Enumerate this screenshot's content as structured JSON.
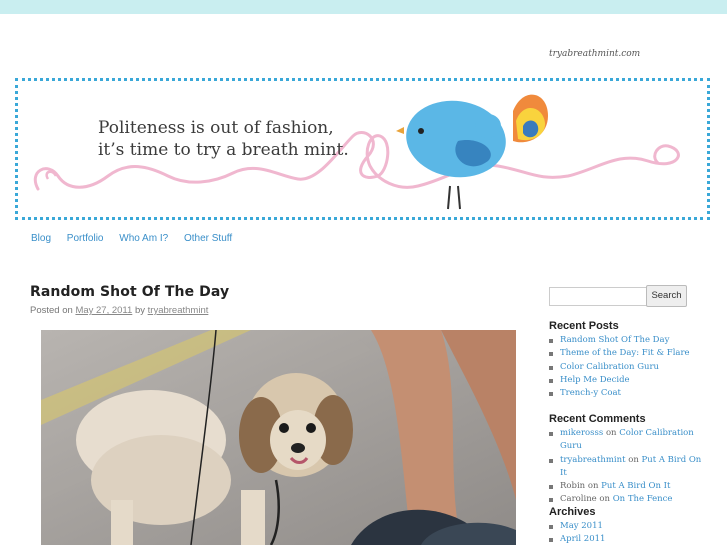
{
  "site": {
    "title": "tryabreathmint.com"
  },
  "header": {
    "tagline_line1": "Politeness is out of fashion,",
    "tagline_line2": "it’s time to try a breath mint."
  },
  "nav": {
    "items": [
      "Blog",
      "Portfolio",
      "Who Am I?",
      "Other Stuff"
    ]
  },
  "post": {
    "title": "Random Shot Of The Day",
    "posted_on": "Posted on",
    "date": "May 27, 2011",
    "by": "by",
    "author": "tryabreathmint"
  },
  "search": {
    "placeholder": "",
    "button": "Search"
  },
  "sidebar": {
    "recent_posts_title": "Recent Posts",
    "recent_posts": [
      "Random Shot Of The Day",
      "Theme of the Day: Fit & Flare",
      "Color Calibration Guru",
      "Help Me Decide",
      "Trench-y Coat"
    ],
    "recent_comments_title": "Recent Comments",
    "recent_comments": [
      {
        "author": "mikerosss",
        "on": "on",
        "post": "Color Calibration Guru"
      },
      {
        "author": "tryabreathmint",
        "on": "on",
        "post": "Put A Bird On It"
      },
      {
        "author": "Robin",
        "on": "on",
        "post": "Put A Bird On It"
      },
      {
        "author": "Caroline",
        "on": "on",
        "post": "On The Fence"
      }
    ],
    "archives_title": "Archives",
    "archives": [
      "May 2011",
      "April 2011"
    ]
  },
  "colors": {
    "accent": "#3a8fc9",
    "topbar": "#c9eef0",
    "border": "#3aa8d8",
    "swirl": "#f0b7cf"
  },
  "icons": {
    "header_bird": "bird-illustration",
    "post_photo": "dog-photo"
  }
}
